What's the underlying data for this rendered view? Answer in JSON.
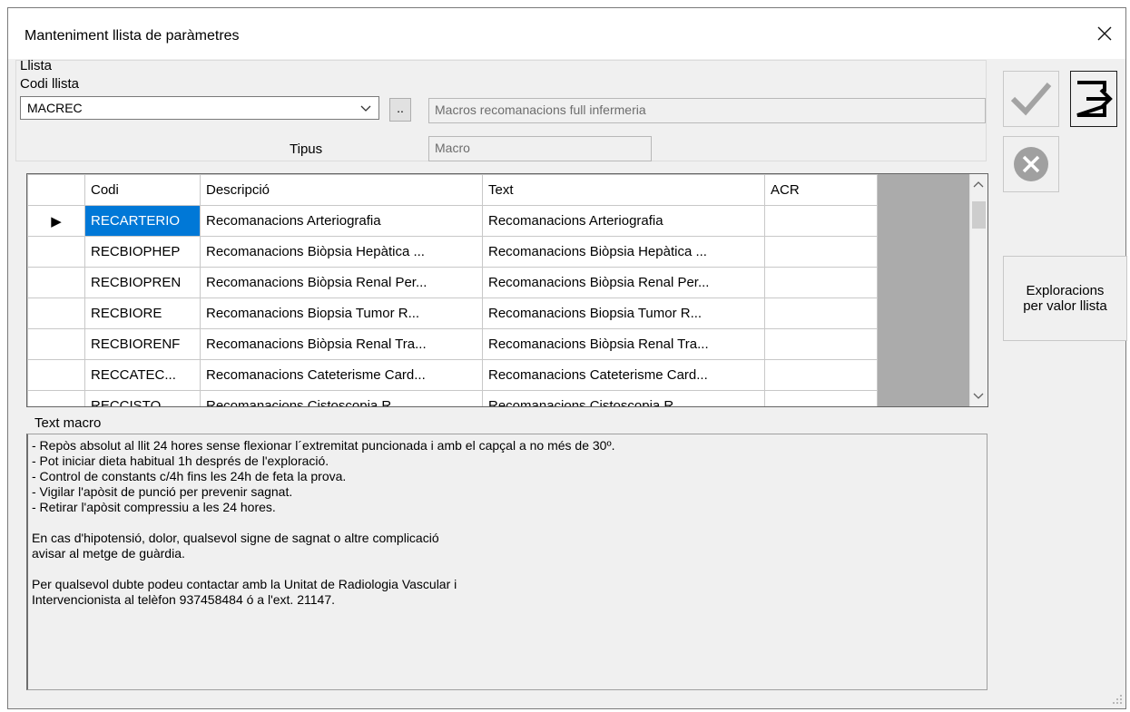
{
  "window": {
    "title": "Manteniment llista de paràmetres"
  },
  "group": {
    "label": "Llista"
  },
  "codi_llista": {
    "label": "Codi llista",
    "value": "MACREC"
  },
  "browse_button": {
    "label": ".."
  },
  "description_field": {
    "value": "Macros recomanacions full infermeria"
  },
  "tipus": {
    "label": "Tipus",
    "value": "Macro"
  },
  "explore_button": {
    "line1": "Exploracions",
    "line2": "per valor llista"
  },
  "grid": {
    "columns": [
      "Codi",
      "Descripció",
      "Text",
      "ACR"
    ],
    "rows": [
      {
        "codi": "RECARTERIO",
        "descripcio": "Recomanacions Arteriografia",
        "text": "Recomanacions Arteriografia",
        "acr": ""
      },
      {
        "codi": "RECBIOPHEP",
        "descripcio": "Recomanacions Biòpsia Hepàtica ...",
        "text": "Recomanacions Biòpsia Hepàtica ...",
        "acr": ""
      },
      {
        "codi": "RECBIOPREN",
        "descripcio": "Recomanacions Biòpsia Renal Per...",
        "text": "Recomanacions Biòpsia Renal Per...",
        "acr": ""
      },
      {
        "codi": "RECBIORE",
        "descripcio": "Recomanacions Biopsia Tumor R...",
        "text": "Recomanacions Biopsia Tumor R...",
        "acr": ""
      },
      {
        "codi": "RECBIORENF",
        "descripcio": "Recomanacions Biòpsia Renal Tra...",
        "text": "Recomanacions Biòpsia Renal Tra...",
        "acr": ""
      },
      {
        "codi": "RECCATEC...",
        "descripcio": "Recomanacions Cateterisme Card...",
        "text": "Recomanacions Cateterisme Card...",
        "acr": ""
      },
      {
        "codi": "RECCISTO...",
        "descripcio": "Recomanacions Cistoscopia R...",
        "text": "Recomanacions Cistoscopia R...",
        "acr": ""
      }
    ],
    "current_row_marker": "▶"
  },
  "macro": {
    "label": "Text macro",
    "lines": [
      "- Repòs absolut al llit 24 hores sense flexionar l´extremitat puncionada i amb el capçal a no més de 30º.",
      "- Pot iniciar dieta habitual 1h després de l'exploració.",
      "- Control de constants c/4h fins les 24h de feta la prova.",
      "- Vigilar l'apòsit de punció per prevenir sagnat.",
      "- Retirar l'apòsit compressiu a les 24 hores.",
      "",
      "En cas d'hipotensió, dolor, qualsevol signe de sagnat o altre complicació",
      "avisar al metge de guàrdia.",
      "",
      "Per qualsevol dubte podeu contactar amb la Unitat de Radiologia Vascular i",
      "Intervencionista al telèfon 937458484 ó a l'ext. 21147."
    ]
  },
  "colors": {
    "selection": "#0078d7",
    "grid_background": "#ababab",
    "window_bg": "#f0f0f0"
  }
}
